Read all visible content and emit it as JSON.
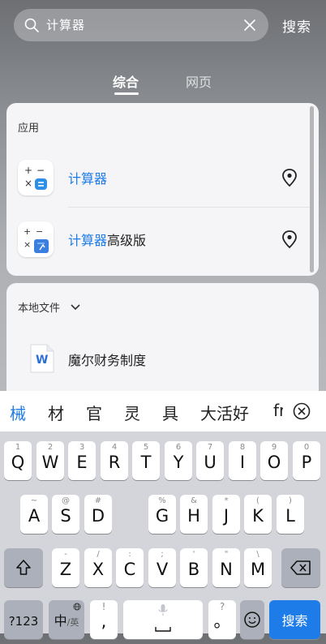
{
  "search": {
    "query": "计算器",
    "button_label": "搜索"
  },
  "tabs": [
    {
      "label": "综合"
    },
    {
      "label": "网页"
    }
  ],
  "apps_section": {
    "title": "应用",
    "items": [
      {
        "highlight": "计算器",
        "suffix": ""
      },
      {
        "highlight": "计算器",
        "suffix": "高级版"
      }
    ]
  },
  "files_section": {
    "title": "本地文件",
    "items": [
      {
        "icon_letter": "W",
        "name": "魔尔财务制度"
      }
    ]
  },
  "candidates": [
    "械",
    "材",
    "官",
    "灵",
    "具",
    "大活好",
    "fr"
  ],
  "keyboard": {
    "row1": [
      {
        "hint": "1",
        "label": "Q"
      },
      {
        "hint": "2",
        "label": "W"
      },
      {
        "hint": "3",
        "label": "E"
      },
      {
        "hint": "4",
        "label": "R"
      },
      {
        "hint": "5",
        "label": "T"
      },
      {
        "hint": "6",
        "label": "Y"
      },
      {
        "hint": "7",
        "label": "U"
      },
      {
        "hint": "8",
        "label": "I"
      },
      {
        "hint": "9",
        "label": "O"
      },
      {
        "hint": "0",
        "label": "P"
      }
    ],
    "row2": [
      {
        "hint": "~",
        "label": "A"
      },
      {
        "hint": "@",
        "label": "S"
      },
      {
        "hint": "#",
        "label": "D"
      },
      {
        "hint": "%",
        "label": "G"
      },
      {
        "hint": "&",
        "label": "H"
      },
      {
        "hint": "*",
        "label": "J"
      },
      {
        "hint": "(",
        "label": "K"
      },
      {
        "hint": ")",
        "label": "L"
      }
    ],
    "row3": [
      {
        "hint": "-",
        "label": "Z"
      },
      {
        "hint": "/",
        "label": "X"
      },
      {
        "hint": ":",
        "label": "C"
      },
      {
        "hint": ";",
        "label": "V"
      },
      {
        "hint": "'",
        "label": "B"
      },
      {
        "hint": "\"",
        "label": "N"
      },
      {
        "hint": "\\",
        "label": "M"
      }
    ],
    "numbers_label": "?123",
    "lang_label": "中",
    "lang_sub": "/英",
    "punct_top": "!",
    "punct_bottom": ",",
    "period_top": "?",
    "period_bottom": "。",
    "enter_label": "搜索"
  },
  "colors": {
    "accent": "#1e7ce8",
    "card": "#f5f5f7",
    "keyboard_bg": "#d3d5da"
  }
}
